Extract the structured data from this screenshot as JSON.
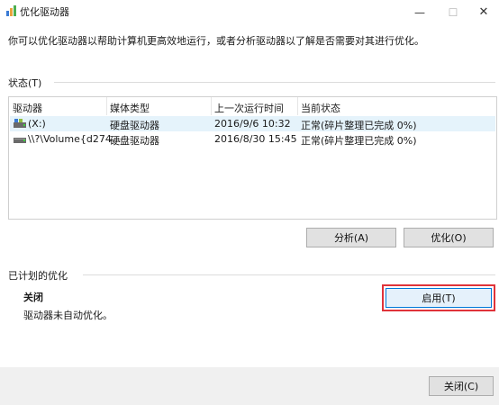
{
  "window": {
    "title": "优化驱动器",
    "min_glyph": "—",
    "max_glyph": "☐",
    "close_glyph": "✕"
  },
  "description": "你可以优化驱动器以帮助计算机更高效地运行，或者分析驱动器以了解是否需要对其进行优化。",
  "status": {
    "label": "状态(T)",
    "columns": [
      "驱动器",
      "媒体类型",
      "上一次运行时间",
      "当前状态"
    ],
    "rows": [
      {
        "drive": "(X:)",
        "media": "硬盘驱动器",
        "last_run": "2016/9/6 10:32",
        "status": "正常(碎片整理已完成 0%)",
        "icon": "drive-icon",
        "selected": true
      },
      {
        "drive": "\\\\?\\Volume{d274...",
        "media": "硬盘驱动器",
        "last_run": "2016/8/30 15:45",
        "status": "正常(碎片整理已完成 0%)",
        "icon": "drive-icon",
        "selected": false
      }
    ]
  },
  "buttons": {
    "analyze": "分析(A)",
    "optimize": "优化(O)"
  },
  "scheduled": {
    "label": "已计划的优化",
    "state": "关闭",
    "note": "驱动器未自动优化。",
    "enable_button": "启用(T)"
  },
  "footer": {
    "close_button": "关闭(C)"
  },
  "colors": {
    "highlight_border": "#e0333a",
    "selected_row": "#e5f3fb",
    "accent": "#0078d7"
  }
}
